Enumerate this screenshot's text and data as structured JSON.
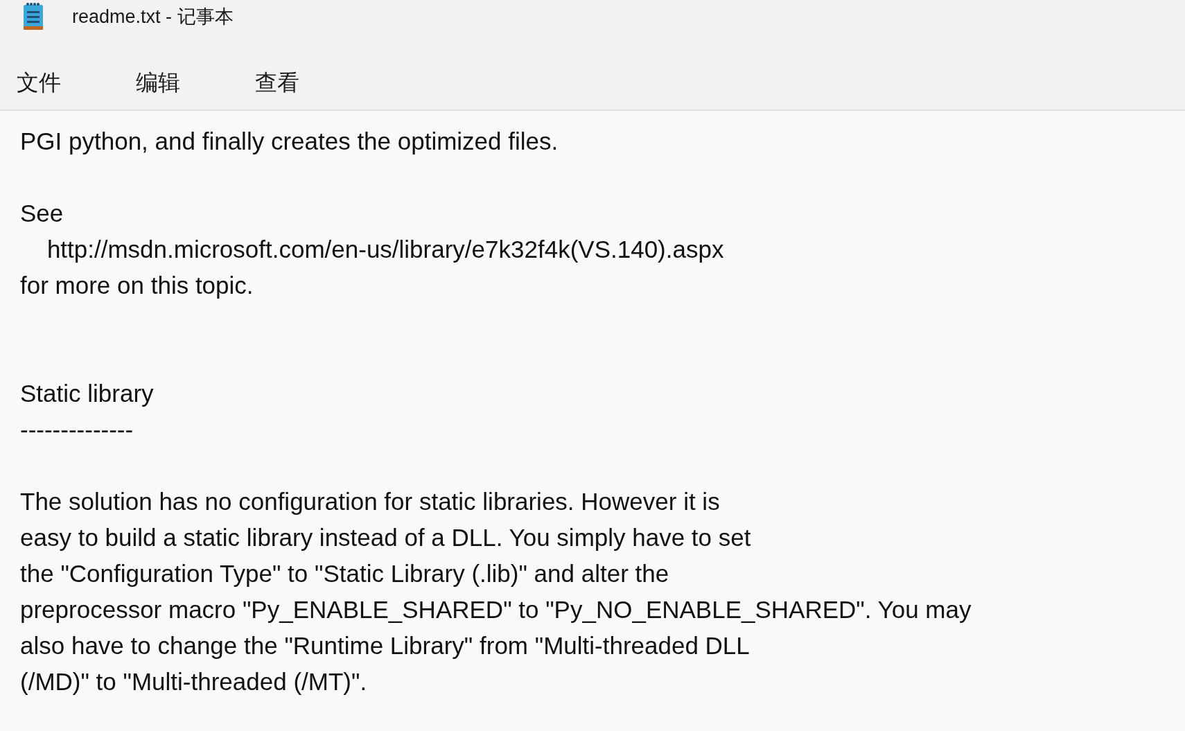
{
  "window": {
    "title": "readme.txt - 记事本"
  },
  "menu": [
    {
      "label": "文件"
    },
    {
      "label": "编辑"
    },
    {
      "label": "查看"
    }
  ],
  "document": {
    "lines": [
      {
        "kind": "text",
        "text": "PGI python, and finally creates the optimized files."
      },
      {
        "kind": "blank"
      },
      {
        "kind": "text",
        "text": "See"
      },
      {
        "kind": "text",
        "text": "    http://msdn.microsoft.com/en-us/library/e7k32f4k(VS.140).aspx"
      },
      {
        "kind": "text",
        "text": "for more on this topic."
      },
      {
        "kind": "blank"
      },
      {
        "kind": "blank"
      },
      {
        "kind": "text",
        "text": "Static library"
      },
      {
        "kind": "text",
        "text": "--------------"
      },
      {
        "kind": "blank"
      },
      {
        "kind": "text",
        "text": "The solution has no configuration for static libraries. However it is"
      },
      {
        "kind": "text",
        "text": "easy to build a static library instead of a DLL. You simply have to set"
      },
      {
        "kind": "text",
        "text": "the \"Configuration Type\" to \"Static Library (.lib)\" and alter the"
      },
      {
        "kind": "text",
        "text": "preprocessor macro \"Py_ENABLE_SHARED\" to \"Py_NO_ENABLE_SHARED\". You may"
      },
      {
        "kind": "text",
        "text": "also have to change the \"Runtime Library\" from \"Multi-threaded DLL"
      },
      {
        "kind": "text",
        "text": "(/MD)\" to \"Multi-threaded (/MT)\"."
      }
    ]
  }
}
